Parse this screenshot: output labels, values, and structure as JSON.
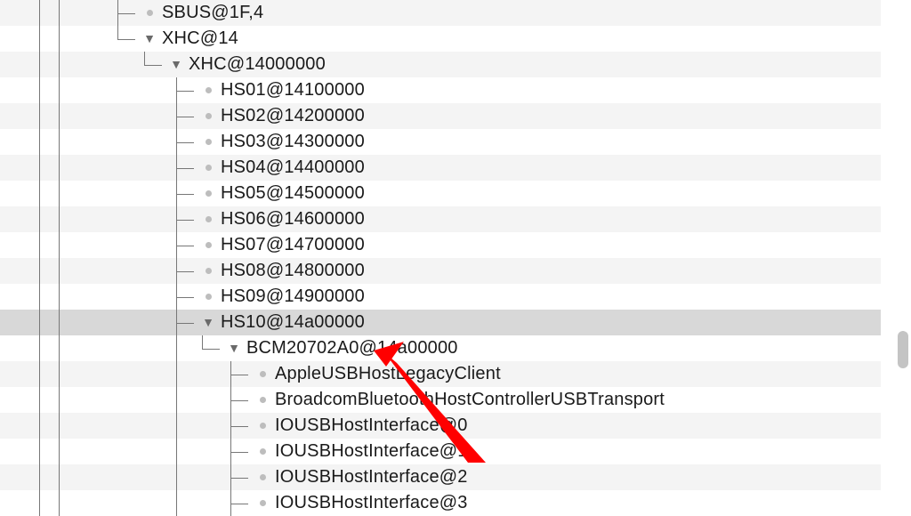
{
  "rows": [
    {
      "label": "SBUS@1F,4",
      "indent": 4,
      "type": "leaf",
      "last": false
    },
    {
      "label": "XHC@14",
      "indent": 4,
      "type": "branch",
      "last": true
    },
    {
      "label": "XHC@14000000",
      "indent": 5,
      "type": "branch",
      "last": true
    },
    {
      "label": "HS01@14100000",
      "indent": 6,
      "type": "leaf",
      "last": false
    },
    {
      "label": "HS02@14200000",
      "indent": 6,
      "type": "leaf",
      "last": false
    },
    {
      "label": "HS03@14300000",
      "indent": 6,
      "type": "leaf",
      "last": false
    },
    {
      "label": "HS04@14400000",
      "indent": 6,
      "type": "leaf",
      "last": false
    },
    {
      "label": "HS05@14500000",
      "indent": 6,
      "type": "leaf",
      "last": false
    },
    {
      "label": "HS06@14600000",
      "indent": 6,
      "type": "leaf",
      "last": false
    },
    {
      "label": "HS07@14700000",
      "indent": 6,
      "type": "leaf",
      "last": false
    },
    {
      "label": "HS08@14800000",
      "indent": 6,
      "type": "leaf",
      "last": false
    },
    {
      "label": "HS09@14900000",
      "indent": 6,
      "type": "leaf",
      "last": false
    },
    {
      "label": "HS10@14a00000",
      "indent": 6,
      "type": "branch",
      "last": false,
      "selected": true
    },
    {
      "label": "BCM20702A0@14a00000",
      "indent": 7,
      "type": "branch",
      "last": true
    },
    {
      "label": "AppleUSBHostLegacyClient",
      "indent": 8,
      "type": "leaf",
      "last": false
    },
    {
      "label": "BroadcomBluetoothHostControllerUSBTransport",
      "indent": 8,
      "type": "leaf",
      "last": false
    },
    {
      "label": "IOUSBHostInterface@0",
      "indent": 8,
      "type": "leaf",
      "last": false
    },
    {
      "label": "IOUSBHostInterface@1",
      "indent": 8,
      "type": "leaf",
      "last": false
    },
    {
      "label": "IOUSBHostInterface@2",
      "indent": 8,
      "type": "leaf",
      "last": false
    },
    {
      "label": "IOUSBHostInterface@3",
      "indent": 8,
      "type": "leaf",
      "last": false
    }
  ],
  "rails_per_level": {
    "4": [
      44,
      66
    ],
    "5": [
      44,
      66
    ],
    "6": [
      44,
      66
    ],
    "7": [
      44,
      66,
      198
    ],
    "8": [
      44,
      66,
      198
    ]
  },
  "conn_left": {
    "4": 132,
    "5": 162,
    "6": 198,
    "7": 227,
    "8": 259
  },
  "annotation": {
    "arrow_target": "BCM20702A0@14a00000",
    "color": "#ff0000"
  }
}
